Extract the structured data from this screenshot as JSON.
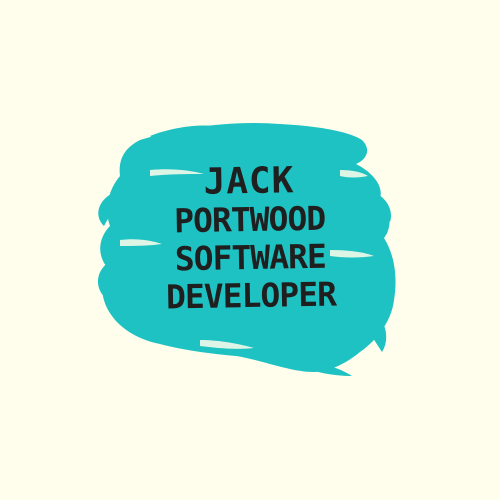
{
  "logo": {
    "lines": [
      "JACK",
      "PORTWOOD",
      "SOFTWARE",
      "DEVELOPER"
    ],
    "text_color": "#1f1f1f",
    "brush_color": "#1fc2c2",
    "background_color": "#fffeec"
  }
}
